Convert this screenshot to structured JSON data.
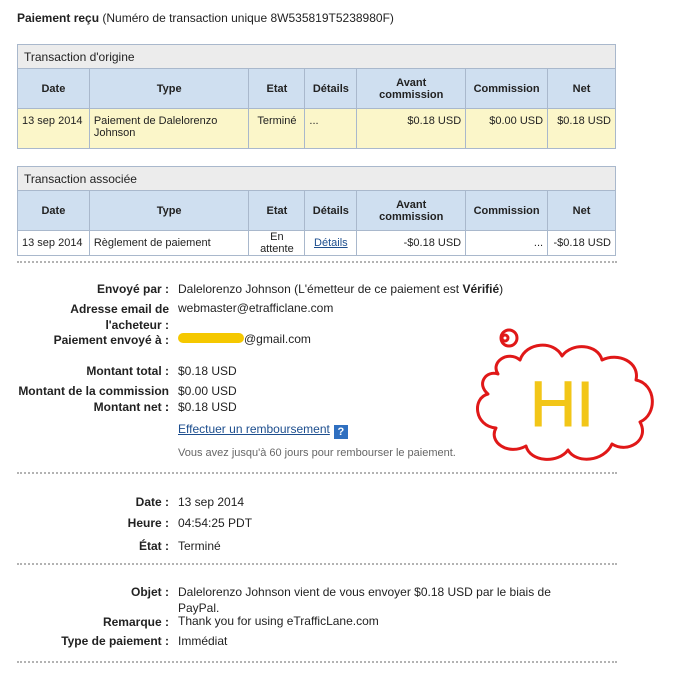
{
  "header": {
    "title": "Paiement reçu",
    "subtitle": "(Numéro de transaction unique 8W535819T5238980F)"
  },
  "columns": {
    "date": "Date",
    "type": "Type",
    "etat": "Etat",
    "details": "Détails",
    "avant_line1": "Avant",
    "avant_line2": "commission",
    "commission": "Commission",
    "net": "Net"
  },
  "origin": {
    "caption": "Transaction d'origine",
    "row": {
      "date": "13 sep 2014",
      "type": "Paiement de Dalelorenzo Johnson",
      "etat": "Terminé",
      "details": "...",
      "avant": "$0.18 USD",
      "commission": "$0.00 USD",
      "net": "$0.18 USD"
    }
  },
  "associated": {
    "caption": "Transaction associée",
    "row": {
      "date": "13 sep 2014",
      "type": "Règlement de paiement",
      "etat": "En attente",
      "details": "Détails",
      "avant": "-$0.18 USD",
      "commission": "...",
      "net": "-$0.18 USD"
    }
  },
  "info": {
    "sent_by_label": "Envoyé par :",
    "sent_by_value": "Dalelorenzo Johnson (L'émetteur de ce paiement est ",
    "sent_by_status": "Vérifié",
    "sent_by_close": ")",
    "buyer_email_label": "Adresse email de l'acheteur :",
    "buyer_email_value": "webmaster@etrafficlane.com",
    "sent_to_label": "Paiement envoyé à :",
    "sent_to_value": "@gmail.com",
    "total_label": "Montant total :",
    "total_value": "$0.18 USD",
    "fee_label": "Montant de la commission :",
    "fee_value": "$0.00 USD",
    "net_label": "Montant net :",
    "net_value": "$0.18 USD",
    "refund_link": "Effectuer un remboursement",
    "help_icon": "?",
    "refund_note": "Vous avez jusqu'à 60 jours pour rembourser le paiement."
  },
  "dates": {
    "date_label": "Date :",
    "date_value": "13 sep 2014",
    "time_label": "Heure :",
    "time_value": "04:54:25 PDT",
    "state_label": "État :",
    "state_value": "Terminé"
  },
  "message": {
    "subject_label": "Objet :",
    "subject_value": "Dalelorenzo Johnson vient de vous envoyer $0.18 USD par le biais de PayPal.",
    "note_label": "Remarque :",
    "note_value": "Thank you for using eTrafficLane.com",
    "ptype_label": "Type de paiement :",
    "ptype_value": "Immédiat"
  },
  "annotation": {
    "text": "HI",
    "ink_color": "#e01818",
    "text_color": "#f2c618",
    "highlight_color": "#f5c800"
  }
}
